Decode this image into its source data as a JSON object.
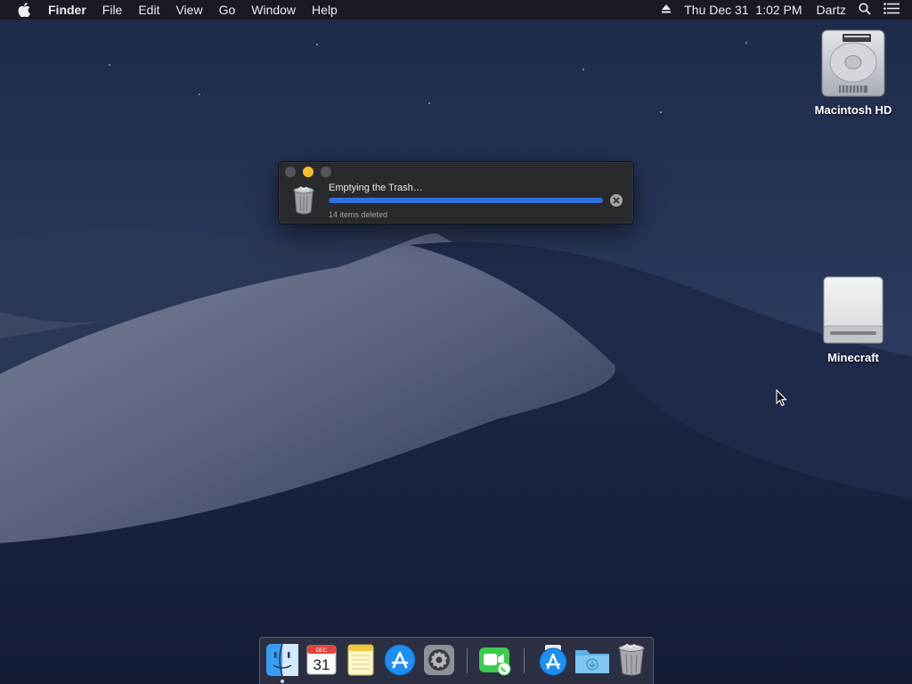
{
  "menubar": {
    "apple_icon": "apple-logo-icon",
    "app_name": "Finder",
    "menus": [
      "File",
      "Edit",
      "View",
      "Go",
      "Window",
      "Help"
    ],
    "eject_icon": "eject-icon",
    "clock": "Thu Dec 31  1:02 PM",
    "user": "Dartz",
    "spotlight_icon": "search-icon",
    "notification_icon": "list-icon"
  },
  "desktop": {
    "icons": [
      {
        "label": "Macintosh HD",
        "icon": "hard-drive-icon"
      },
      {
        "label": "Minecraft",
        "icon": "external-drive-icon"
      }
    ]
  },
  "dialog": {
    "title": "Emptying the Trash…",
    "subtitle": "14 items deleted",
    "progress": 1.0,
    "colors": {
      "progress": "#2f6fe0",
      "minimize": "#f5bd2f"
    }
  },
  "dock": {
    "calendar_month": "DEC",
    "calendar_day": "31",
    "items": [
      "finder-icon",
      "calendar-icon",
      "notes-icon",
      "app-store-icon",
      "system-preferences-icon",
      "facetime-icon",
      "downloads-stack-icon",
      "folder-icon",
      "trash-icon"
    ]
  }
}
